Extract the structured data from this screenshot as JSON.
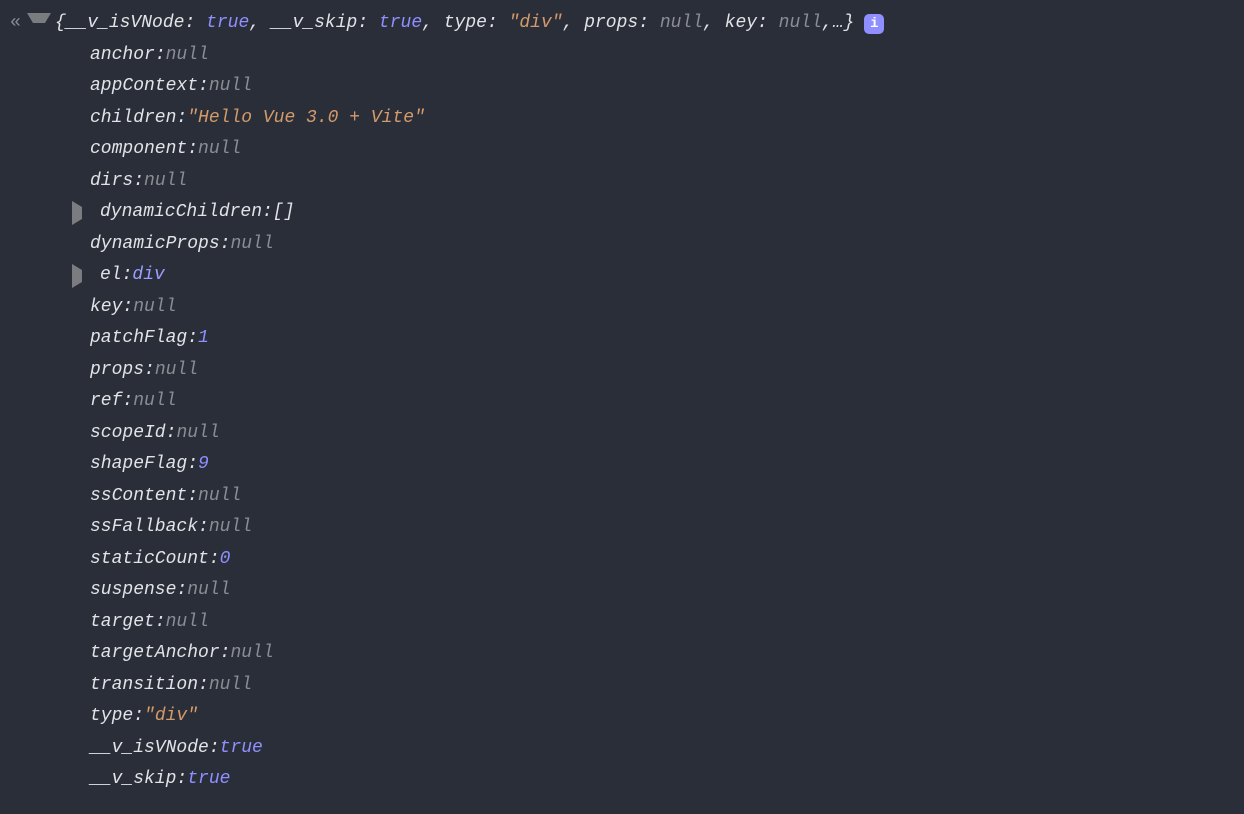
{
  "info_badge": "i",
  "summary": {
    "open": "{",
    "close": "…}",
    "pairs": [
      {
        "k": "__v_isVNode",
        "v": "true",
        "cls": "true"
      },
      {
        "k": "__v_skip",
        "v": "true",
        "cls": "true"
      },
      {
        "k": "type",
        "v": "\"div\"",
        "cls": "str"
      },
      {
        "k": "props",
        "v": "null",
        "cls": "null"
      },
      {
        "k": "key",
        "v": "null",
        "cls": "null"
      }
    ]
  },
  "props": [
    {
      "k": "anchor",
      "v": "null",
      "cls": "null",
      "arrow": null
    },
    {
      "k": "appContext",
      "v": "null",
      "cls": "null",
      "arrow": null
    },
    {
      "k": "children",
      "v": "\"Hello Vue 3.0 + Vite\"",
      "cls": "str",
      "arrow": null
    },
    {
      "k": "component",
      "v": "null",
      "cls": "null",
      "arrow": null
    },
    {
      "k": "dirs",
      "v": "null",
      "cls": "null",
      "arrow": null
    },
    {
      "k": "dynamicChildren",
      "v": "[]",
      "cls": "punc",
      "arrow": "right"
    },
    {
      "k": "dynamicProps",
      "v": "null",
      "cls": "null",
      "arrow": null
    },
    {
      "k": "el",
      "v": "div",
      "cls": "elref",
      "arrow": "right"
    },
    {
      "k": "key",
      "v": "null",
      "cls": "null",
      "arrow": null
    },
    {
      "k": "patchFlag",
      "v": "1",
      "cls": "num",
      "arrow": null
    },
    {
      "k": "props",
      "v": "null",
      "cls": "null",
      "arrow": null
    },
    {
      "k": "ref",
      "v": "null",
      "cls": "null",
      "arrow": null
    },
    {
      "k": "scopeId",
      "v": "null",
      "cls": "null",
      "arrow": null
    },
    {
      "k": "shapeFlag",
      "v": "9",
      "cls": "num",
      "arrow": null
    },
    {
      "k": "ssContent",
      "v": "null",
      "cls": "null",
      "arrow": null
    },
    {
      "k": "ssFallback",
      "v": "null",
      "cls": "null",
      "arrow": null
    },
    {
      "k": "staticCount",
      "v": "0",
      "cls": "num",
      "arrow": null
    },
    {
      "k": "suspense",
      "v": "null",
      "cls": "null",
      "arrow": null
    },
    {
      "k": "target",
      "v": "null",
      "cls": "null",
      "arrow": null
    },
    {
      "k": "targetAnchor",
      "v": "null",
      "cls": "null",
      "arrow": null
    },
    {
      "k": "transition",
      "v": "null",
      "cls": "null",
      "arrow": null
    },
    {
      "k": "type",
      "v": "\"div\"",
      "cls": "str",
      "arrow": null
    },
    {
      "k": "__v_isVNode",
      "v": "true",
      "cls": "true",
      "arrow": null
    },
    {
      "k": "__v_skip",
      "v": "true",
      "cls": "true",
      "arrow": null
    }
  ]
}
